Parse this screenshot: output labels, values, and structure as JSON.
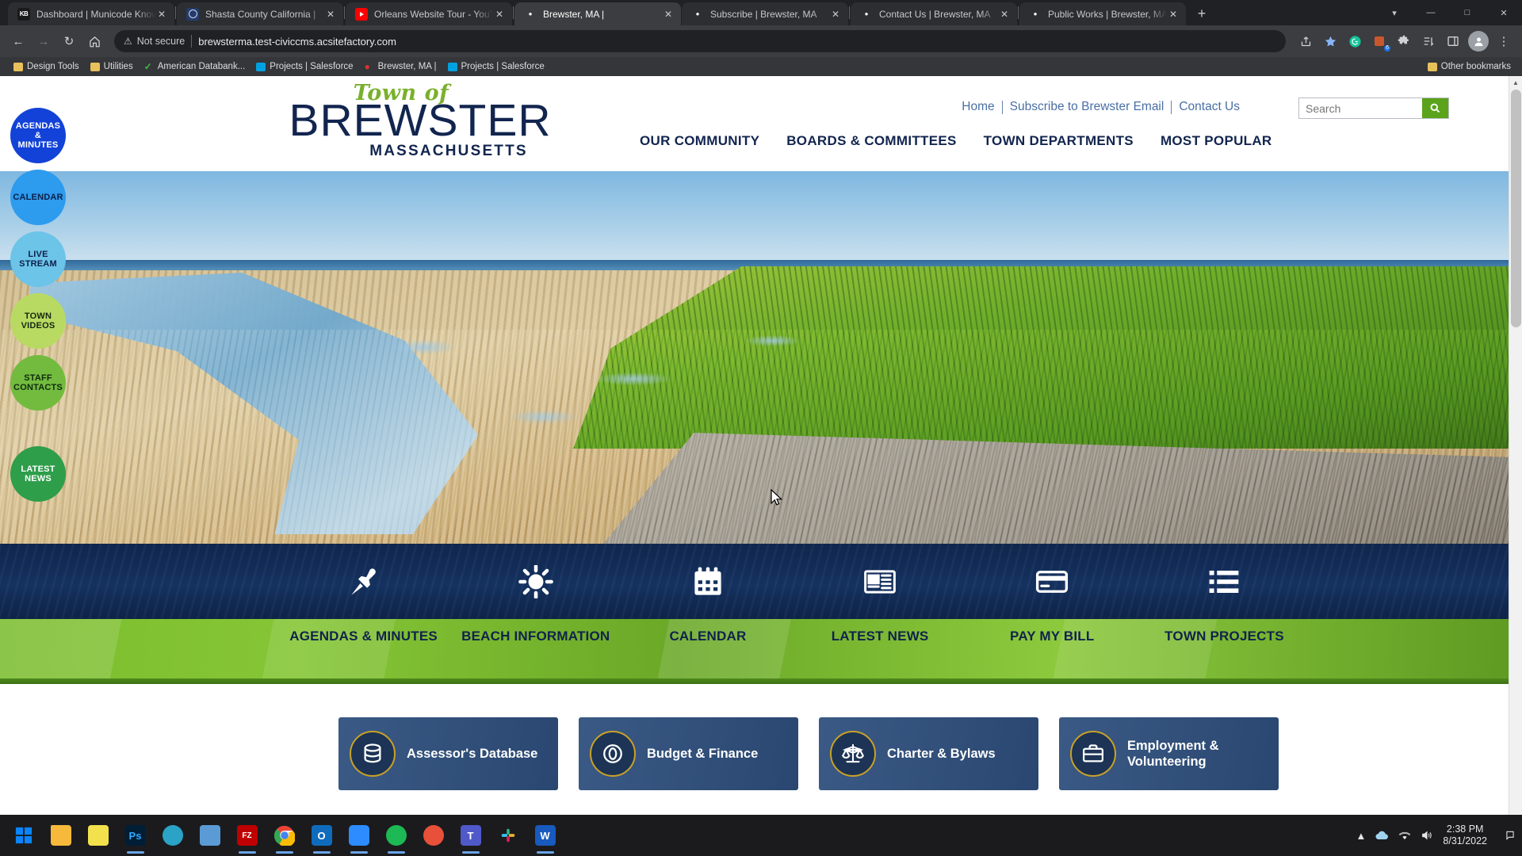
{
  "browser": {
    "tabs": [
      {
        "title": "Dashboard | Municode Knowled",
        "icon": "municode-kb-favicon",
        "active": false
      },
      {
        "title": "Shasta County California |",
        "icon": "county-seal-favicon",
        "active": false
      },
      {
        "title": "Orleans Website Tour - YouTube",
        "icon": "youtube-favicon",
        "active": false
      },
      {
        "title": "Brewster, MA |",
        "icon": "civicplus-favicon",
        "active": true
      },
      {
        "title": "Subscribe | Brewster, MA",
        "icon": "civicplus-favicon",
        "active": false
      },
      {
        "title": "Contact Us | Brewster, MA",
        "icon": "civicplus-favicon",
        "active": false
      },
      {
        "title": "Public Works | Brewster, MA",
        "icon": "civicplus-favicon",
        "active": false
      }
    ],
    "new_tab_label": "+",
    "window_controls": {
      "minimize": "—",
      "maximize": "❐",
      "close": "✕"
    },
    "nav": {
      "back": "←",
      "forward": "→",
      "reload": "↻",
      "home": "⌂"
    },
    "omnibox": {
      "security_label": "Not secure",
      "warning_icon": "warning-triangle-icon",
      "url": "brewsterma.test-civiccms.acsitefactory.com"
    },
    "toolbar_right": {
      "share_icon": "share-icon",
      "bookmark_icon": "star-icon",
      "grammarly_icon": "grammarly-icon",
      "extension_count": "6",
      "puzzle_icon": "extensions-puzzle-icon",
      "reading_list_icon": "reading-list-icon",
      "side_panel_icon": "side-panel-icon",
      "profile_icon": "profile-avatar-icon",
      "menu_icon": "three-dot-menu-icon"
    },
    "bookmarks": [
      {
        "label": "Design Tools",
        "icon": "folder-icon"
      },
      {
        "label": "Utilities",
        "icon": "folder-icon"
      },
      {
        "label": "American Databank...",
        "icon": "green-check-icon"
      },
      {
        "label": "Projects | Salesforce",
        "icon": "salesforce-cloud-icon"
      },
      {
        "label": "Brewster, MA |",
        "icon": "civicplus-icon"
      },
      {
        "label": "Projects | Salesforce",
        "icon": "salesforce-cloud-icon"
      }
    ],
    "other_bookmarks": {
      "label": "Other bookmarks",
      "icon": "folder-icon"
    }
  },
  "site": {
    "logo": {
      "eyebrow": "Town of",
      "name": "BREWSTER",
      "state": "MASSACHUSETTS"
    },
    "utility_nav": [
      "Home",
      "Subscribe to Brewster Email",
      "Contact Us"
    ],
    "search": {
      "placeholder": "Search",
      "value": "",
      "button_icon": "search-icon",
      "accent": "#5aa31a"
    },
    "main_nav": [
      "OUR COMMUNITY",
      "BOARDS & COMMITTEES",
      "TOWN DEPARTMENTS",
      "MOST POPULAR"
    ],
    "side_buttons": [
      {
        "label": "AGENDAS & MINUTES",
        "color": "#1242d8"
      },
      {
        "label": "CALENDAR",
        "color": "#2d9bee"
      },
      {
        "label": "LIVE STREAM",
        "color": "#6cc4e8"
      },
      {
        "label": "TOWN VIDEOS",
        "color": "#b9da62"
      },
      {
        "label": "STAFF CONTACTS",
        "color": "#73bb3f"
      }
    ],
    "side_buttons_lower": [
      {
        "label": "LATEST NEWS",
        "color": "#2e9e4a"
      }
    ],
    "quick_links": [
      {
        "label": "AGENDAS & MINUTES",
        "icon": "pushpin-icon"
      },
      {
        "label": "BEACH INFORMATION",
        "icon": "sun-icon"
      },
      {
        "label": "CALENDAR",
        "icon": "calendar-icon"
      },
      {
        "label": "LATEST NEWS",
        "icon": "newspaper-icon"
      },
      {
        "label": "PAY MY BILL",
        "icon": "credit-card-icon"
      },
      {
        "label": "TOWN PROJECTS",
        "icon": "list-icon"
      }
    ],
    "department_cards": [
      {
        "label": "Assessor's Database",
        "icon": "database-icon"
      },
      {
        "label": "Budget & Finance",
        "icon": "coin-icon"
      },
      {
        "label": "Charter & Bylaws",
        "icon": "scales-icon"
      },
      {
        "label": "Employment & Volunteering",
        "icon": "briefcase-icon"
      }
    ],
    "colors": {
      "navy": "#12254f",
      "green": "#7bbd2e",
      "card": "#2e4f7d",
      "gold": "#c9a227"
    }
  },
  "taskbar": {
    "start_icon": "windows-start-icon",
    "apps": [
      {
        "name": "file-explorer",
        "label": "",
        "color": "#f7b733"
      },
      {
        "name": "notepad",
        "label": "",
        "color": "#f4e04d"
      },
      {
        "name": "photoshop",
        "label": "Ps",
        "color": "#001e36"
      },
      {
        "name": "adobe-app",
        "label": "",
        "color": "#2ba3c7"
      },
      {
        "name": "snipping-tool",
        "label": "",
        "color": "#5b9bd5"
      },
      {
        "name": "filezilla",
        "label": "FZ",
        "color": "#bf0000"
      },
      {
        "name": "google-chrome",
        "label": "",
        "color": "#ffffff"
      },
      {
        "name": "outlook",
        "label": "",
        "color": "#0f6cbd"
      },
      {
        "name": "zoom",
        "label": "",
        "color": "#2d8cff"
      },
      {
        "name": "spotify",
        "label": "",
        "color": "#1db954"
      },
      {
        "name": "app-orange",
        "label": "",
        "color": "#e8503a"
      },
      {
        "name": "microsoft-teams",
        "label": "",
        "color": "#5059c9"
      },
      {
        "name": "slack",
        "label": "",
        "color": "#4a154b"
      },
      {
        "name": "microsoft-word",
        "label": "W",
        "color": "#185abd"
      }
    ],
    "tray": {
      "chevron": "show-hidden-icons",
      "cloud": "onedrive-icon",
      "wifi": "wifi-icon",
      "volume": "volume-icon",
      "time": "2:38 PM",
      "date": "8/31/2022",
      "notifications": "notification-center-icon"
    }
  }
}
